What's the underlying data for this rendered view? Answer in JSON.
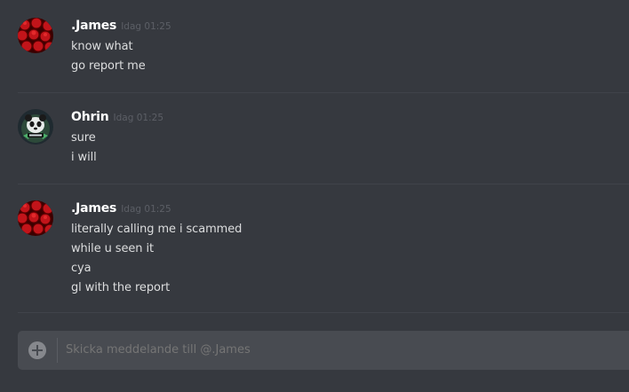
{
  "messages": [
    {
      "author": ".James",
      "timestamp": "Idag 01:25",
      "avatar_icon": "red-hexagon-avatar",
      "lines": [
        "know what",
        "go report me"
      ]
    },
    {
      "author": "Ohrin",
      "timestamp": "Idag 01:25",
      "avatar_icon": "panda-avatar",
      "lines": [
        "sure",
        "i will"
      ]
    },
    {
      "author": ".James",
      "timestamp": "Idag 01:25",
      "avatar_icon": "red-hexagon-avatar",
      "lines": [
        "literally calling me i scammed",
        "while u seen it",
        "cya",
        "gl with the report"
      ]
    }
  ],
  "composer": {
    "placeholder": "Skicka meddelande till @.James",
    "attach_icon": "plus-circle-icon"
  },
  "colors": {
    "background": "#36393f",
    "composer_bg": "#484b51",
    "username": "#ffffff",
    "message_text": "#dcddde",
    "timestamp": "#5c5f66"
  }
}
